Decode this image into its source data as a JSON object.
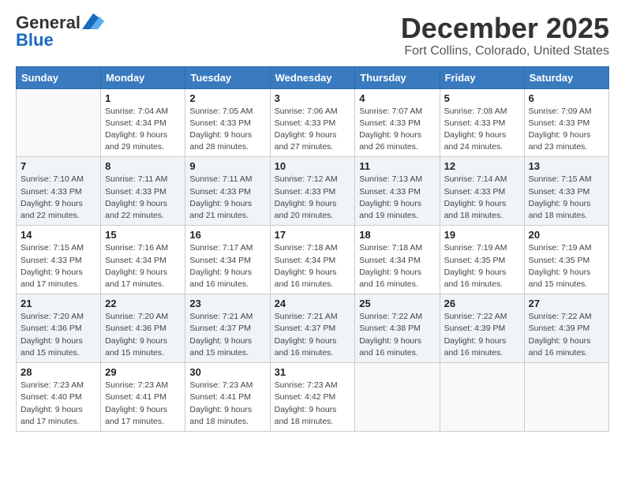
{
  "header": {
    "logo_general": "General",
    "logo_blue": "Blue",
    "month": "December 2025",
    "location": "Fort Collins, Colorado, United States"
  },
  "weekdays": [
    "Sunday",
    "Monday",
    "Tuesday",
    "Wednesday",
    "Thursday",
    "Friday",
    "Saturday"
  ],
  "weeks": [
    [
      {
        "day": "",
        "info": ""
      },
      {
        "day": "1",
        "info": "Sunrise: 7:04 AM\nSunset: 4:34 PM\nDaylight: 9 hours\nand 29 minutes."
      },
      {
        "day": "2",
        "info": "Sunrise: 7:05 AM\nSunset: 4:33 PM\nDaylight: 9 hours\nand 28 minutes."
      },
      {
        "day": "3",
        "info": "Sunrise: 7:06 AM\nSunset: 4:33 PM\nDaylight: 9 hours\nand 27 minutes."
      },
      {
        "day": "4",
        "info": "Sunrise: 7:07 AM\nSunset: 4:33 PM\nDaylight: 9 hours\nand 26 minutes."
      },
      {
        "day": "5",
        "info": "Sunrise: 7:08 AM\nSunset: 4:33 PM\nDaylight: 9 hours\nand 24 minutes."
      },
      {
        "day": "6",
        "info": "Sunrise: 7:09 AM\nSunset: 4:33 PM\nDaylight: 9 hours\nand 23 minutes."
      }
    ],
    [
      {
        "day": "7",
        "info": "Sunrise: 7:10 AM\nSunset: 4:33 PM\nDaylight: 9 hours\nand 22 minutes."
      },
      {
        "day": "8",
        "info": "Sunrise: 7:11 AM\nSunset: 4:33 PM\nDaylight: 9 hours\nand 22 minutes."
      },
      {
        "day": "9",
        "info": "Sunrise: 7:11 AM\nSunset: 4:33 PM\nDaylight: 9 hours\nand 21 minutes."
      },
      {
        "day": "10",
        "info": "Sunrise: 7:12 AM\nSunset: 4:33 PM\nDaylight: 9 hours\nand 20 minutes."
      },
      {
        "day": "11",
        "info": "Sunrise: 7:13 AM\nSunset: 4:33 PM\nDaylight: 9 hours\nand 19 minutes."
      },
      {
        "day": "12",
        "info": "Sunrise: 7:14 AM\nSunset: 4:33 PM\nDaylight: 9 hours\nand 18 minutes."
      },
      {
        "day": "13",
        "info": "Sunrise: 7:15 AM\nSunset: 4:33 PM\nDaylight: 9 hours\nand 18 minutes."
      }
    ],
    [
      {
        "day": "14",
        "info": "Sunrise: 7:15 AM\nSunset: 4:33 PM\nDaylight: 9 hours\nand 17 minutes."
      },
      {
        "day": "15",
        "info": "Sunrise: 7:16 AM\nSunset: 4:34 PM\nDaylight: 9 hours\nand 17 minutes."
      },
      {
        "day": "16",
        "info": "Sunrise: 7:17 AM\nSunset: 4:34 PM\nDaylight: 9 hours\nand 16 minutes."
      },
      {
        "day": "17",
        "info": "Sunrise: 7:18 AM\nSunset: 4:34 PM\nDaylight: 9 hours\nand 16 minutes."
      },
      {
        "day": "18",
        "info": "Sunrise: 7:18 AM\nSunset: 4:34 PM\nDaylight: 9 hours\nand 16 minutes."
      },
      {
        "day": "19",
        "info": "Sunrise: 7:19 AM\nSunset: 4:35 PM\nDaylight: 9 hours\nand 16 minutes."
      },
      {
        "day": "20",
        "info": "Sunrise: 7:19 AM\nSunset: 4:35 PM\nDaylight: 9 hours\nand 15 minutes."
      }
    ],
    [
      {
        "day": "21",
        "info": "Sunrise: 7:20 AM\nSunset: 4:36 PM\nDaylight: 9 hours\nand 15 minutes."
      },
      {
        "day": "22",
        "info": "Sunrise: 7:20 AM\nSunset: 4:36 PM\nDaylight: 9 hours\nand 15 minutes."
      },
      {
        "day": "23",
        "info": "Sunrise: 7:21 AM\nSunset: 4:37 PM\nDaylight: 9 hours\nand 15 minutes."
      },
      {
        "day": "24",
        "info": "Sunrise: 7:21 AM\nSunset: 4:37 PM\nDaylight: 9 hours\nand 16 minutes."
      },
      {
        "day": "25",
        "info": "Sunrise: 7:22 AM\nSunset: 4:38 PM\nDaylight: 9 hours\nand 16 minutes."
      },
      {
        "day": "26",
        "info": "Sunrise: 7:22 AM\nSunset: 4:39 PM\nDaylight: 9 hours\nand 16 minutes."
      },
      {
        "day": "27",
        "info": "Sunrise: 7:22 AM\nSunset: 4:39 PM\nDaylight: 9 hours\nand 16 minutes."
      }
    ],
    [
      {
        "day": "28",
        "info": "Sunrise: 7:23 AM\nSunset: 4:40 PM\nDaylight: 9 hours\nand 17 minutes."
      },
      {
        "day": "29",
        "info": "Sunrise: 7:23 AM\nSunset: 4:41 PM\nDaylight: 9 hours\nand 17 minutes."
      },
      {
        "day": "30",
        "info": "Sunrise: 7:23 AM\nSunset: 4:41 PM\nDaylight: 9 hours\nand 18 minutes."
      },
      {
        "day": "31",
        "info": "Sunrise: 7:23 AM\nSunset: 4:42 PM\nDaylight: 9 hours\nand 18 minutes."
      },
      {
        "day": "",
        "info": ""
      },
      {
        "day": "",
        "info": ""
      },
      {
        "day": "",
        "info": ""
      }
    ]
  ]
}
